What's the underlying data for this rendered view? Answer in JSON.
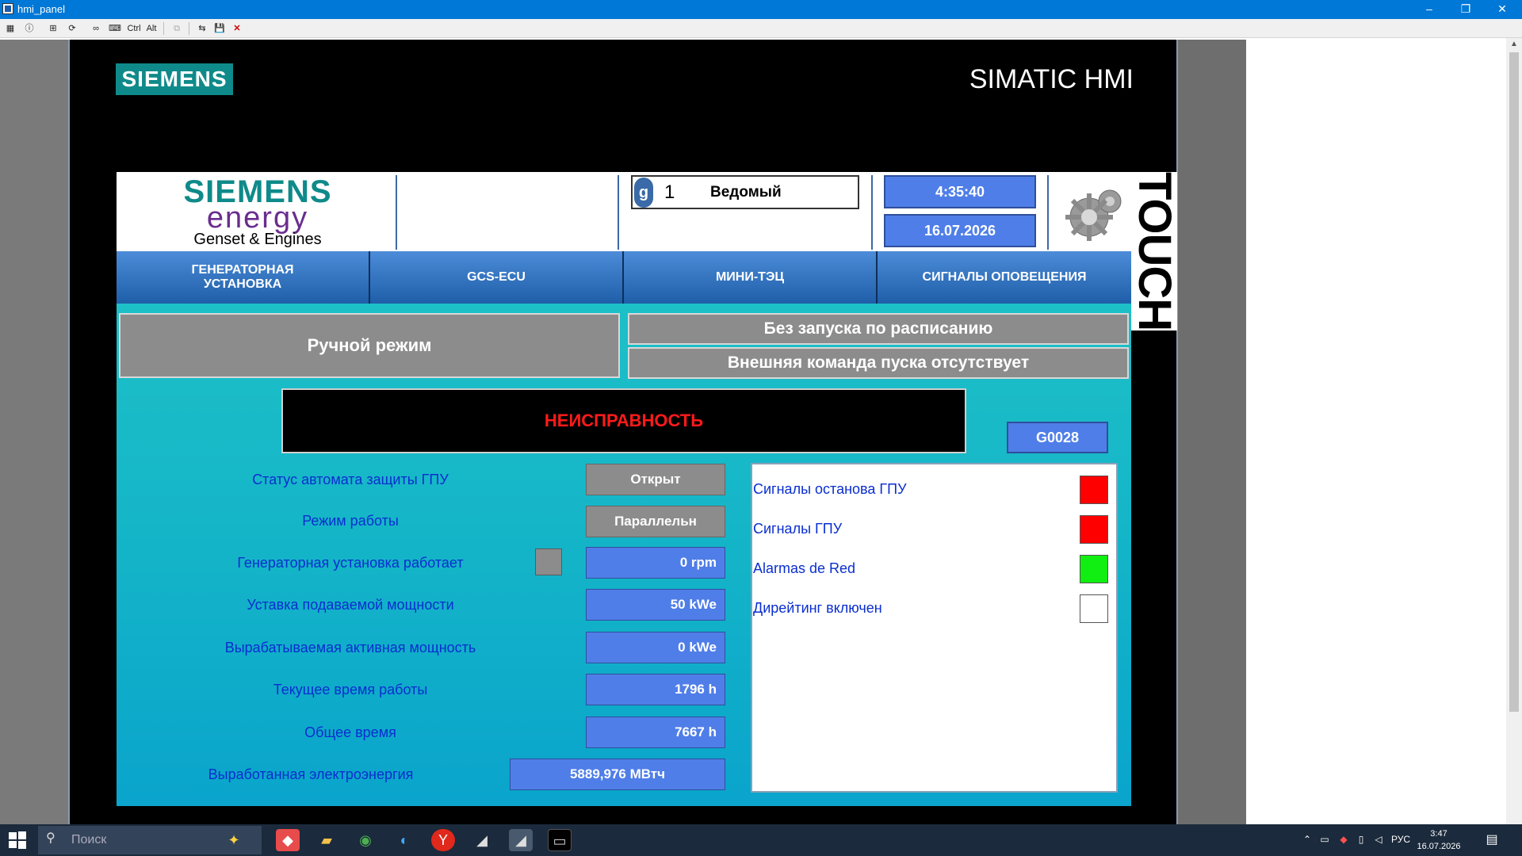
{
  "window": {
    "title": "hmi_panel",
    "minimize": "–",
    "restore": "❐",
    "close": "✕"
  },
  "toolbar": {
    "ctrl_label": "Ctrl",
    "alt_label": "Alt"
  },
  "panel": {
    "brand": "SIEMENS",
    "hmi_title": "SIMATIC HMI",
    "touch_label": "TOUCH"
  },
  "header": {
    "logo_siemens": "SIEMENS",
    "logo_energy": "energy",
    "logo_genset": "Genset & Engines",
    "user_number": "1",
    "user_role": "Ведомый",
    "time": "4:35:40",
    "date": "16.07.2026"
  },
  "nav": {
    "items": [
      {
        "label": "ГЕНЕРАТОРНАЯ УСТАНОВКА"
      },
      {
        "label": "GCS-ECU"
      },
      {
        "label": "МИНИ-ТЭЦ"
      },
      {
        "label": "СИГНАЛЫ ОПОВЕЩЕНИЯ"
      }
    ]
  },
  "modes": {
    "manual": "Ручной режим",
    "schedule": "Без запуска по расписанию",
    "external": "Внешняя команда пуска отсутствует"
  },
  "status": {
    "fault": "НЕИСПРАВНОСТЬ",
    "code": "G0028"
  },
  "params": [
    {
      "label": "Статус автомата защиты ГПУ",
      "value": "Открыт"
    },
    {
      "label": "Режим работы",
      "value": "Параллельн"
    },
    {
      "label": "Генераторная установка работает",
      "value": "0 rpm"
    },
    {
      "label": "Уставка подаваемой мощности",
      "value": "50 kWe"
    },
    {
      "label": "Вырабатываемая активная мощность",
      "value": "0 kWe"
    },
    {
      "label": "Текущее время работы",
      "value": "1796 h"
    },
    {
      "label": "Общее время",
      "value": "7667 h"
    },
    {
      "label": "Выработанная электроэнергия",
      "value": "5889,976  МВтч"
    }
  ],
  "signals": [
    {
      "label": "Сигналы останова ГПУ",
      "color": "#ff0000"
    },
    {
      "label": "Сигналы ГПУ",
      "color": "#ff0000"
    },
    {
      "label": "Alarmas de Red",
      "color": "#11ee11"
    },
    {
      "label": "Дирейтинг включен",
      "color": "#ffffff"
    }
  ],
  "taskbar": {
    "search_placeholder": "Поиск",
    "lang": "РУС",
    "time": "3:47",
    "date": "16.07.2026"
  }
}
